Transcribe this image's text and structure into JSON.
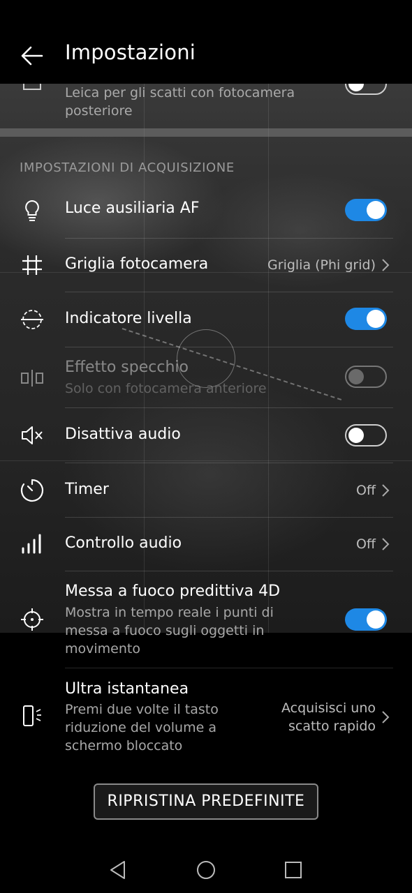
{
  "header": {
    "title": "Impostazioni"
  },
  "partial_item": {
    "text": "Leica per gli scatti con fotocamera posteriore",
    "line1": "Leica per gli scatti con fotocamera",
    "line2": "posteriore"
  },
  "section": {
    "title": "IMPOSTAZIONI DI ACQUISIZIONE"
  },
  "settings": [
    {
      "label": "Luce ausiliaria AF",
      "type": "toggle",
      "state": "on",
      "icon": "lightbulb-icon"
    },
    {
      "label": "Griglia fotocamera",
      "type": "value",
      "value": "Griglia (Phi grid)",
      "icon": "grid-icon"
    },
    {
      "label": "Indicatore livella",
      "type": "toggle",
      "state": "on",
      "icon": "level-icon"
    },
    {
      "label": "Effetto specchio",
      "subtitle": "Solo con fotocamera anteriore",
      "type": "toggle",
      "state": "disabled-off",
      "icon": "mirror-icon"
    },
    {
      "label": "Disattiva audio",
      "type": "toggle",
      "state": "off",
      "icon": "mute-icon"
    },
    {
      "label": "Timer",
      "type": "value",
      "value": "Off",
      "icon": "timer-icon"
    },
    {
      "label": "Controllo audio",
      "type": "value",
      "value": "Off",
      "icon": "audio-bars-icon"
    },
    {
      "label": "Messa a fuoco predittiva 4D",
      "subtitle": "Mostra in tempo reale i punti di messa a fuoco sugli oggetti in movimento",
      "subtitle_lines": [
        "Mostra in tempo reale i punti di",
        "messa a fuoco sugli oggetti in",
        "movimento"
      ],
      "type": "toggle",
      "state": "on",
      "icon": "crosshair-icon"
    },
    {
      "label": "Ultra istantanea",
      "subtitle": "Premi due volte il tasto riduzione del volume a schermo bloccato",
      "subtitle_lines": [
        "Premi due volte il tasto",
        "riduzione del volume a",
        "schermo bloccato"
      ],
      "type": "value",
      "value": "Acquisisci uno scatto rapido",
      "value_lines": [
        "Acquisisci uno",
        "scatto rapido"
      ],
      "icon": "phone-side-button-icon"
    }
  ],
  "reset_button": {
    "label": "RIPRISTINA PREDEFINITE"
  },
  "colors": {
    "accent": "#1e88e5",
    "background": "#000000"
  },
  "navbar": {
    "icons": [
      "back-triangle-icon",
      "home-circle-icon",
      "recents-square-icon"
    ]
  }
}
